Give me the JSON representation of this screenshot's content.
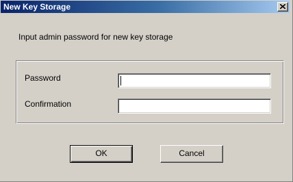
{
  "window": {
    "title": "New Key Storage",
    "close_icon": "close-icon"
  },
  "prompt": "Input admin password for new key storage",
  "form": {
    "password_label": "Password",
    "password_value": "",
    "confirmation_label": "Confirmation",
    "confirmation_value": ""
  },
  "buttons": {
    "ok_label": "OK",
    "cancel_label": "Cancel"
  }
}
